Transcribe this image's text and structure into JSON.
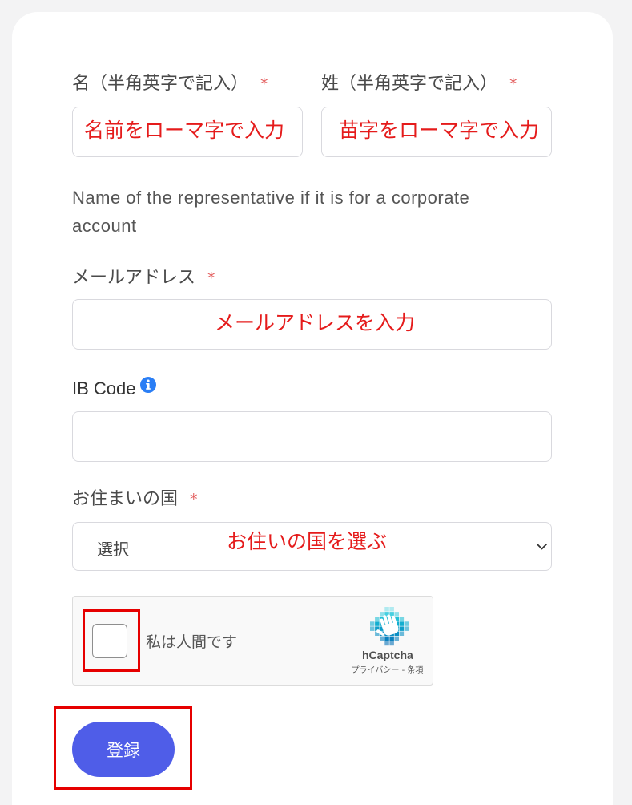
{
  "colors": {
    "accent": "#4f5de8",
    "required": "#e35d5d",
    "annotation": "#e51b1b",
    "info": "#2a7ef5",
    "highlight": "#e60000"
  },
  "form": {
    "first_name": {
      "label": "名（半角英字で記入）",
      "required_mark": "*",
      "annotation": "名前をローマ字で入力"
    },
    "last_name": {
      "label": "姓（半角英字で記入）",
      "required_mark": "*",
      "annotation": "苗字をローマ字で入力"
    },
    "name_help": "Name of the representative if it is for a corporate account",
    "email": {
      "label": "メールアドレス",
      "required_mark": "*",
      "annotation": "メールアドレスを入力"
    },
    "ib_code": {
      "label": "IB Code",
      "info_icon": "info-circle-icon"
    },
    "country": {
      "label": "お住まいの国",
      "required_mark": "*",
      "selected": "選択",
      "annotation": "お住いの国を選ぶ",
      "dropdown_icon": "chevron-down-icon"
    },
    "captcha": {
      "checkbox_label": "私は人間です",
      "checked": false,
      "logo_icon": "hcaptcha-logo-icon",
      "brand": "hCaptcha",
      "privacy_link": "プライバシー",
      "separator": "-",
      "terms_link": "条項"
    },
    "submit_label": "登録"
  }
}
